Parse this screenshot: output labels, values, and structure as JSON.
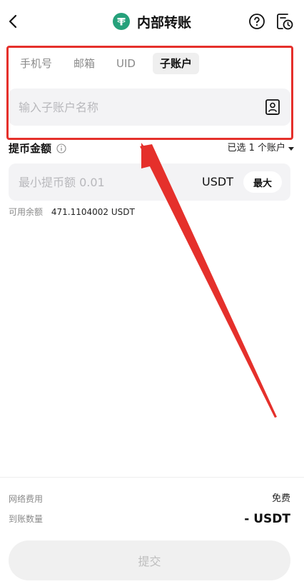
{
  "header": {
    "title": "内部转账",
    "coin_icon": "tether-icon",
    "coin_color": "#26a17b"
  },
  "tabs": [
    {
      "label": "手机号",
      "active": false
    },
    {
      "label": "邮箱",
      "active": false
    },
    {
      "label": "UID",
      "active": false
    },
    {
      "label": "子账户",
      "active": true
    }
  ],
  "recipient": {
    "placeholder": "输入子账户名称",
    "value": ""
  },
  "amount": {
    "label": "提币金额",
    "selected_accounts": "已选 1 个账户",
    "placeholder": "最小提币额 0.01",
    "unit": "USDT",
    "max_label": "最大"
  },
  "balance": {
    "label": "可用余额",
    "value": "471.1104002 USDT"
  },
  "footer": {
    "fee_label": "网络费用",
    "fee_value": "免费",
    "receive_label": "到账数量",
    "receive_value": "- USDT",
    "submit_label": "提交"
  },
  "annotation": {
    "highlight_color": "#e5302b"
  }
}
